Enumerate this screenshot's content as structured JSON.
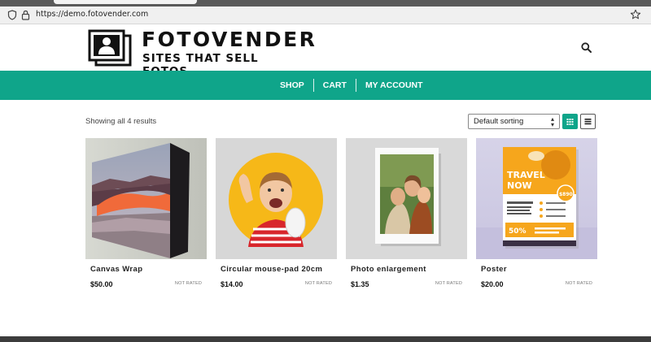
{
  "browser": {
    "url": "https://demo.fotovender.com"
  },
  "header": {
    "logo_name": "FOTOVENDER",
    "logo_tagline": "SITES THAT SELL FOTOS"
  },
  "nav": {
    "items": [
      "SHOP",
      "CART",
      "MY ACCOUNT"
    ]
  },
  "shop": {
    "result_count": "Showing all 4 results",
    "sorting": "Default sorting"
  },
  "products": [
    {
      "title": "Canvas Wrap",
      "price": "$50.00",
      "rating": "NOT RATED"
    },
    {
      "title": "Circular mouse-pad 20cm",
      "price": "$14.00",
      "rating": "NOT RATED"
    },
    {
      "title": "Photo enlargement",
      "price": "$1.35",
      "rating": "NOT RATED"
    },
    {
      "title": "Poster",
      "price": "$20.00",
      "rating": "NOT RATED"
    }
  ],
  "poster_art": {
    "line1": "TRAVEL",
    "line2": "NOW",
    "price_tag": "$890",
    "promo": "50%"
  },
  "colors": {
    "accent": "#0fa58a",
    "footer": "#3c3c3c"
  }
}
